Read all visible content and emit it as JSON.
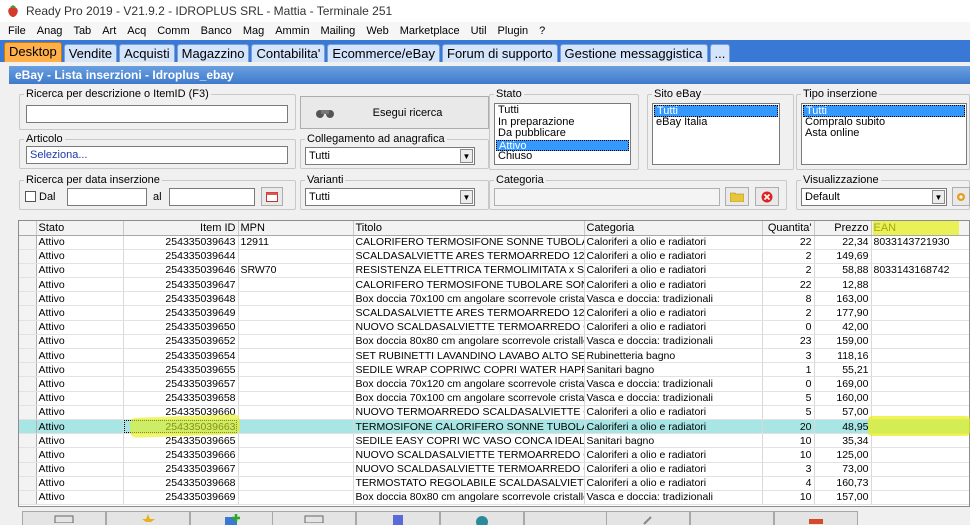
{
  "window": {
    "title": "Ready Pro 2019 - V21.9.2 - IDROPLUS SRL - Mattia - Terminale 251"
  },
  "menu": [
    "File",
    "Anag",
    "Tab",
    "Art",
    "Acq",
    "Comm",
    "Banco",
    "Mag",
    "Ammin",
    "Mailing",
    "Web",
    "Marketplace",
    "Util",
    "Plugin",
    "?"
  ],
  "tabs": [
    "Desktop",
    "Vendite",
    "Acquisti",
    "Magazzino",
    "Contabilita'",
    "Ecommerce/eBay",
    "Forum di supporto",
    "Gestione messaggistica",
    "..."
  ],
  "panel": {
    "title": "eBay - Lista inserzioni - Idroplus_ebay"
  },
  "filters": {
    "search_label": "Ricerca per descrizione o ItemID (F3)",
    "search_value": "",
    "run_search": "Esegui ricerca",
    "articolo_label": "Articolo",
    "articolo_value": "Seleziona...",
    "collegamento_label": "Collegamento ad anagrafica",
    "collegamento_value": "Tutti",
    "date_label": "Ricerca per data inserzione",
    "dal_label": "Dal",
    "al_label": "al",
    "varianti_label": "Varianti",
    "varianti_value": "Tutti",
    "stato_label": "Stato",
    "stato_options": [
      "Tutti",
      "In preparazione",
      "Da pubblicare",
      "Attivo",
      "Chiuso"
    ],
    "stato_selected": "Attivo",
    "sito_label": "Sito eBay",
    "sito_options": [
      "Tutti",
      "eBay Italia"
    ],
    "sito_selected": "Tutti",
    "tipo_label": "Tipo inserzione",
    "tipo_options": [
      "Tutti",
      "Compralo subito",
      "Asta online"
    ],
    "tipo_selected": "Tutti",
    "categoria_label": "Categoria",
    "categoria_value": "",
    "visual_label": "Visualizzazione",
    "visual_value": "Default"
  },
  "grid": {
    "columns": [
      "Stato",
      "Item ID",
      "MPN",
      "Titolo",
      "Categoria",
      "Quantita'",
      "Prezzo",
      "EAN"
    ],
    "rows": [
      [
        "Attivo",
        "254335039643",
        "12911",
        "CALORIFERO TERMOSIFONE SONNE TUBOLARE 2 ...",
        "Caloriferi a olio e radiatori",
        "22",
        "22,34",
        "8033143721930"
      ],
      [
        "Attivo",
        "254335039644",
        "",
        "SCALDASALVIETTE ARES TERMOARREDO 120x50 i...",
        "Caloriferi a olio e radiatori",
        "2",
        "149,69",
        ""
      ],
      [
        "Attivo",
        "254335039646",
        "SRW70",
        "RESISTENZA ELETTRICA TERMOLIMITATA x SCALD...",
        "Caloriferi a olio e radiatori",
        "2",
        "58,88",
        "8033143168742"
      ],
      [
        "Attivo",
        "254335039647",
        "",
        "CALORIFERO TERMOSIFONE TUBOLARE SONNE 2 ...",
        "Caloriferi a olio e radiatori",
        "22",
        "12,88",
        ""
      ],
      [
        "Attivo",
        "254335039648",
        "",
        "Box doccia 70x100 cm angolare scorrevole cristallo ...",
        "Vasca e doccia: tradizionali",
        "8",
        "163,00",
        ""
      ],
      [
        "Attivo",
        "254335039649",
        "",
        "SCALDASALVIETTE ARES TERMOARREDO 120x60 i...",
        "Caloriferi a olio e radiatori",
        "2",
        "177,90",
        ""
      ],
      [
        "Attivo",
        "254335039650",
        "",
        "NUOVO SCALDASALVIETTE TERMOARREDO CITY 1...",
        "Caloriferi a olio e radiatori",
        "0",
        "42,00",
        ""
      ],
      [
        "Attivo",
        "254335039652",
        "",
        "Box doccia 80x80 cm angolare scorrevole cristallo t...",
        "Vasca e doccia: tradizionali",
        "23",
        "159,00",
        ""
      ],
      [
        "Attivo",
        "254335039654",
        "",
        "SET RUBINETTI LAVANDINO LAVABO ALTO SENZA ...",
        "Rubinetteria bagno",
        "3",
        "118,16",
        ""
      ],
      [
        "Attivo",
        "254335039655",
        "",
        "SEDILE WRAP COPRIWC COPRI WATER HAPPY D D...",
        "Sanitari bagno",
        "1",
        "55,21",
        ""
      ],
      [
        "Attivo",
        "254335039657",
        "",
        "Box doccia 70x120 cm angolare scorrevole cristallo ...",
        "Vasca e doccia: tradizionali",
        "0",
        "169,00",
        ""
      ],
      [
        "Attivo",
        "254335039658",
        "",
        "Box doccia 70x100 cm angolare scorrevole cristallo ...",
        "Vasca e doccia: tradizionali",
        "5",
        "160,00",
        ""
      ],
      [
        "Attivo",
        "254335039660",
        "",
        "NUOVO TERMOARREDO SCALDASALVIETTE CITY 1...",
        "Caloriferi a olio e radiatori",
        "5",
        "57,00",
        ""
      ],
      [
        "Attivo",
        "254335039663",
        "",
        "TERMOSIFONE CALORIFERO SONNE TUBOLARE 4 ...",
        "Caloriferi a olio e radiatori",
        "20",
        "48,95",
        ""
      ],
      [
        "Attivo",
        "254335039665",
        "",
        "SEDILE EASY COPRI WC VASO CONCA IDEAL STAN...",
        "Sanitari bagno",
        "10",
        "35,34",
        ""
      ],
      [
        "Attivo",
        "254335039666",
        "",
        "NUOVO SCALDASALVIETTE TERMOARREDO CITY 1...",
        "Caloriferi a olio e radiatori",
        "10",
        "125,00",
        ""
      ],
      [
        "Attivo",
        "254335039667",
        "",
        "NUOVO SCALDASALVIETTE TERMOARREDO CITY BI...",
        "Caloriferi a olio e radiatori",
        "3",
        "73,00",
        ""
      ],
      [
        "Attivo",
        "254335039668",
        "",
        "TERMOSTATO REGOLABILE SCALDASALVIETTE RES...",
        "Caloriferi a olio e radiatori",
        "4",
        "160,73",
        ""
      ],
      [
        "Attivo",
        "254335039669",
        "",
        "Box doccia 80x80 cm angolare scorrevole cristallo t...",
        "Vasca e doccia: tradizionali",
        "10",
        "157,00",
        ""
      ]
    ],
    "selected_index": 13
  },
  "colors": {
    "tabbar": "#3a78d6",
    "active_tab": "#ffb04a",
    "selected_row": "#a8e6e6",
    "highlight": "#e8f01e"
  }
}
